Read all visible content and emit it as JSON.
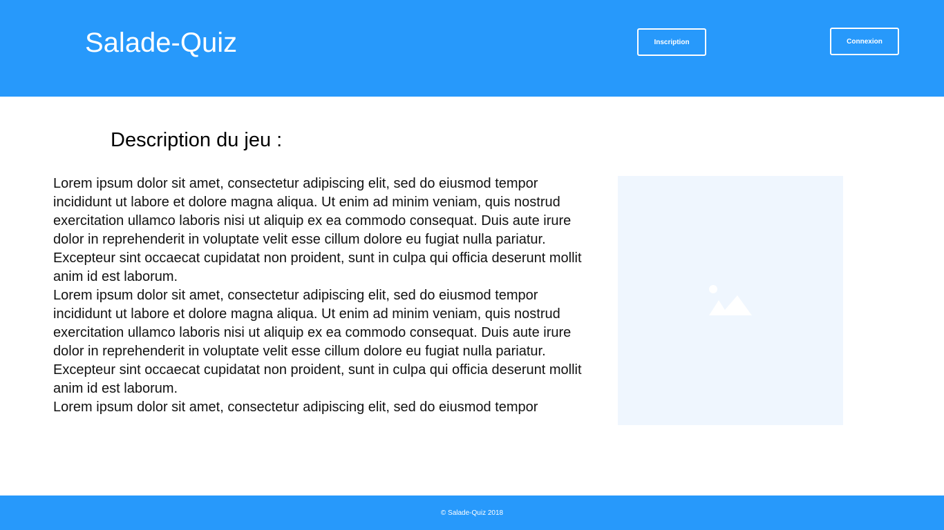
{
  "header": {
    "brand": "Salade-Quiz",
    "nav": {
      "inscription_label": "Inscription",
      "connexion_label": "Connexion"
    }
  },
  "main": {
    "title": "Description du jeu :",
    "paragraphs": [
      "Lorem ipsum dolor sit amet, consectetur adipiscing elit, sed do eiusmod tempor incididunt ut labore et dolore magna aliqua. Ut enim ad minim veniam, quis nostrud exercitation ullamco laboris nisi ut aliquip ex ea commodo consequat. Duis aute irure dolor in reprehenderit in voluptate velit esse cillum dolore eu fugiat nulla pariatur. Excepteur sint occaecat cupidatat non proident, sunt in culpa qui officia deserunt mollit anim id est laborum.",
      "Lorem ipsum dolor sit amet, consectetur adipiscing elit, sed do eiusmod tempor incididunt ut labore et dolore magna aliqua. Ut enim ad minim veniam, quis nostrud exercitation ullamco laboris nisi ut aliquip ex ea commodo consequat. Duis aute irure dolor in reprehenderit in voluptate velit esse cillum dolore eu fugiat nulla pariatur. Excepteur sint occaecat cupidatat non proident, sunt in culpa qui officia deserunt mollit anim id est laborum.",
      "Lorem ipsum dolor sit amet, consectetur adipiscing elit, sed do eiusmod tempor"
    ],
    "image_icon": "image-icon"
  },
  "footer": {
    "copyright": "© Salade-Quiz 2018"
  },
  "colors": {
    "brand_blue": "#2799fb",
    "placeholder_bg": "#eff6fe",
    "white": "#ffffff"
  }
}
